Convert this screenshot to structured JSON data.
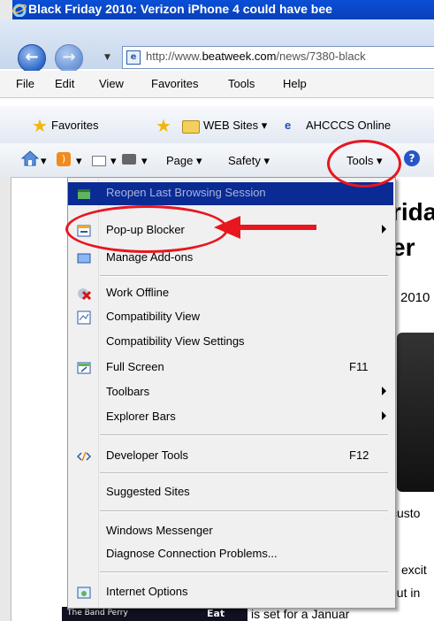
{
  "window": {
    "title": "Black Friday 2010: Verizon iPhone 4 could have bee"
  },
  "address_bar": {
    "url_prefix": "http://www.",
    "url_domain": "beatweek.com",
    "url_rest": "/news/7380-black"
  },
  "menu_bar": {
    "items": [
      "File",
      "Edit",
      "View",
      "Favorites",
      "Tools",
      "Help"
    ]
  },
  "favorites_bar": {
    "favorites_label": "Favorites",
    "web_sites_label": "WEB Sites",
    "ahcccs_label": "AHCCCS Online"
  },
  "command_bar": {
    "page_label": "Page",
    "safety_label": "Safety",
    "tools_label": "Tools"
  },
  "tools_menu": {
    "items": [
      {
        "label": "Reopen Last Browsing Session",
        "shortcut": "",
        "submenu": false,
        "icon": "reopen-session-icon"
      },
      {
        "label": "Pop-up Blocker",
        "shortcut": "",
        "submenu": true,
        "icon": "popup-blocker-icon"
      },
      {
        "label": "Manage Add-ons",
        "shortcut": "",
        "submenu": false,
        "icon": "addons-icon"
      },
      {
        "label": "Work Offline",
        "shortcut": "",
        "submenu": false,
        "icon": "work-offline-icon"
      },
      {
        "label": "Compatibility View",
        "shortcut": "",
        "submenu": false,
        "icon": "compatibility-view-icon"
      },
      {
        "label": "Compatibility View Settings",
        "shortcut": "",
        "submenu": false,
        "icon": ""
      },
      {
        "label": "Full Screen",
        "shortcut": "F11",
        "submenu": false,
        "icon": "full-screen-icon"
      },
      {
        "label": "Toolbars",
        "shortcut": "",
        "submenu": true,
        "icon": ""
      },
      {
        "label": "Explorer Bars",
        "shortcut": "",
        "submenu": true,
        "icon": ""
      },
      {
        "label": "Developer Tools",
        "shortcut": "F12",
        "submenu": false,
        "icon": "developer-tools-icon"
      },
      {
        "label": "Suggested Sites",
        "shortcut": "",
        "submenu": false,
        "icon": ""
      },
      {
        "label": "Windows Messenger",
        "shortcut": "",
        "submenu": false,
        "icon": ""
      },
      {
        "label": "Diagnose Connection Problems...",
        "shortcut": "",
        "submenu": false,
        "icon": ""
      },
      {
        "label": "Internet Options",
        "shortcut": "",
        "submenu": false,
        "icon": "internet-options-icon"
      }
    ]
  },
  "page_background": {
    "headline_fragment_1": "rida",
    "headline_fragment_2": "er",
    "date_fragment": "2010",
    "text_fragment_1": "custo",
    "text_fragment_2": "excit",
    "text_fragment_3": "out in",
    "text_fragment_4": "is set for a Januar",
    "bottom_image_text_1": "The Band Perry",
    "bottom_image_text_2": "Eat"
  },
  "colors": {
    "annotation_red": "#e8161e",
    "menu_highlight": "#0a2a94",
    "titlebar_blue": "#0a4fd6"
  }
}
